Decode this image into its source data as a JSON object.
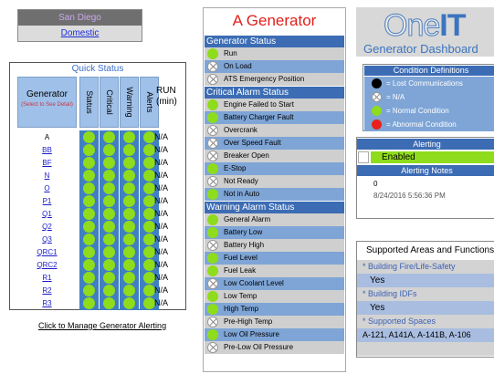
{
  "site": {
    "name": "San Diego",
    "type": "Domestic"
  },
  "quick_status": {
    "title": "Quick Status",
    "generator_header": "Generator",
    "generator_subheader": "(Select to See Detail)",
    "columns": [
      "Status",
      "Critical",
      "Warning",
      "Alerts"
    ],
    "run_header": "RUN (min)",
    "rows": [
      {
        "name": "A",
        "run": "N/A"
      },
      {
        "name": "BB",
        "run": "N/A"
      },
      {
        "name": "BF",
        "run": "N/A"
      },
      {
        "name": "N",
        "run": "N/A"
      },
      {
        "name": "O",
        "run": "N/A"
      },
      {
        "name": "P1",
        "run": "N/A"
      },
      {
        "name": "Q1",
        "run": "N/A"
      },
      {
        "name": "Q2",
        "run": "N/A"
      },
      {
        "name": "Q3",
        "run": "N/A"
      },
      {
        "name": "QRC1",
        "run": "N/A"
      },
      {
        "name": "QRC2",
        "run": "N/A"
      },
      {
        "name": "R1",
        "run": "N/A"
      },
      {
        "name": "R2",
        "run": "N/A"
      },
      {
        "name": "R3",
        "run": "N/A"
      }
    ],
    "manage_link": "Click to Manage Generator Alerting"
  },
  "generator": {
    "title": "A Generator",
    "sections": [
      {
        "header": "Generator Status",
        "items": [
          {
            "label": "Run",
            "state": "ok"
          },
          {
            "label": "On Load",
            "state": "na"
          },
          {
            "label": "ATS Emergency Position",
            "state": "na"
          }
        ]
      },
      {
        "header": "Critical Alarm Status",
        "items": [
          {
            "label": "Engine Failed to Start",
            "state": "ok"
          },
          {
            "label": "Battery Charger Fault",
            "state": "ok"
          },
          {
            "label": "Overcrank",
            "state": "na"
          },
          {
            "label": "Over Speed Fault",
            "state": "na"
          },
          {
            "label": "Breaker Open",
            "state": "na"
          },
          {
            "label": "E-Stop",
            "state": "ok"
          },
          {
            "label": "Not Ready",
            "state": "na"
          },
          {
            "label": "Not in Auto",
            "state": "ok"
          }
        ]
      },
      {
        "header": "Warning Alarm Status",
        "items": [
          {
            "label": "General Alarm",
            "state": "ok"
          },
          {
            "label": "Battery Low",
            "state": "ok"
          },
          {
            "label": "Battery High",
            "state": "na"
          },
          {
            "label": "Fuel Level",
            "state": "ok"
          },
          {
            "label": "Fuel Leak",
            "state": "ok"
          },
          {
            "label": "Low Coolant Level",
            "state": "na"
          },
          {
            "label": "Low Temp",
            "state": "ok"
          },
          {
            "label": "High Temp",
            "state": "ok"
          },
          {
            "label": "Pre-High Temp",
            "state": "na"
          },
          {
            "label": "Low Oil Pressure",
            "state": "ok"
          },
          {
            "label": "Pre-Low Oil Pressure",
            "state": "na"
          }
        ]
      }
    ]
  },
  "brand": {
    "one": "One",
    "it": "IT",
    "subtitle": "Generator Dashboard"
  },
  "conditions": {
    "title": "Condition Definitions",
    "items": [
      {
        "label": "= Lost Communications",
        "icon": "black-circle-icon"
      },
      {
        "label": "= N/A",
        "icon": "na-x-icon"
      },
      {
        "label": "= Normal Condition",
        "icon": "green-circle-icon"
      },
      {
        "label": "= Abnormal Condition",
        "icon": "red-circle-icon"
      }
    ]
  },
  "alerting": {
    "title": "Alerting",
    "state": "Enabled",
    "notes_title": "Alerting Notes",
    "notes_count": "0",
    "notes_date": "8/24/2016 5:56:36 PM"
  },
  "areas": {
    "title": "Supported Areas and Functions",
    "fire_label": "* Building Fire/Life-Safety",
    "fire_value": "Yes",
    "idf_label": "* Building IDFs",
    "idf_value": "Yes",
    "spaces_label": "* Supported Spaces",
    "spaces_value": "A-121, A141A, A-141B, A-106"
  },
  "colors": {
    "accent_blue": "#3c6cb4",
    "ok_green": "#8edc1b",
    "alarm_red": "#e0201b"
  }
}
